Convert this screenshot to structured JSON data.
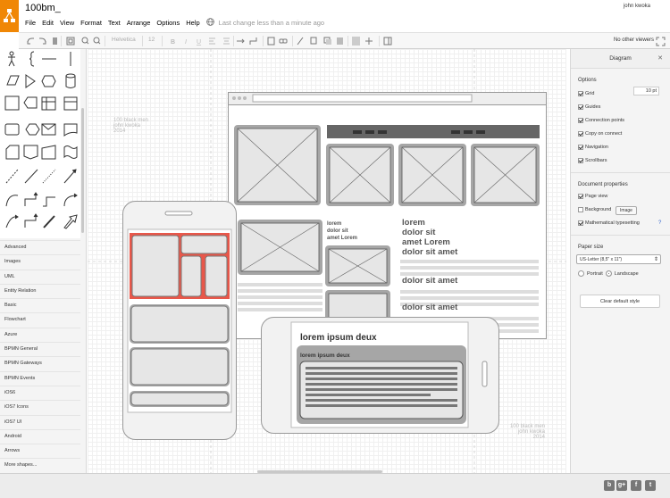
{
  "app": {
    "doc_title": "100bm_",
    "user": "john kwoka",
    "last_change": "Last change less than a minute ago",
    "menu": [
      "File",
      "Edit",
      "View",
      "Format",
      "Text",
      "Arrange",
      "Options",
      "Help"
    ]
  },
  "toolbar": {
    "font_name": "Helvetica",
    "font_size": "12",
    "viewers": "No other viewers",
    "icons": [
      "undo-icon",
      "redo-icon",
      "delete-icon",
      "fit-icon",
      "zoom-in-icon",
      "zoom-out-icon",
      "bold-icon",
      "italic-icon",
      "underline-icon",
      "align-left-icon",
      "align-center-icon",
      "valign-icon",
      "connector-icon",
      "waypoint-icon",
      "image-icon",
      "link-icon",
      "fill-icon",
      "line-color-icon",
      "shadow-icon",
      "to-front-icon",
      "grid-icon",
      "add-icon",
      "format-panel-icon",
      "fullscreen-icon"
    ]
  },
  "sidebar": {
    "libraries": [
      "Advanced",
      "Images",
      "UML",
      "Entity Relation",
      "Basic",
      "Flowchart",
      "Azure",
      "BPMN General",
      "BPMN Gateways",
      "BPMN Events",
      "iOS6",
      "iOS7 Icons",
      "iOS7 UI",
      "Android",
      "Arrows",
      "More shapes..."
    ]
  },
  "canvas": {
    "credit_top": {
      "line1": "100 black men",
      "line2": "john kwoka",
      "line3": "2014"
    },
    "credit_bottom": {
      "line1": "100 black men",
      "line2": "john kwoka",
      "line3": "2014"
    },
    "web_text": {
      "small_lines": [
        "lorem",
        "dolor sit",
        "amet Lorem"
      ],
      "big_lines": [
        "lorem",
        "dolor sit",
        "amet Lorem",
        "dolor sit amet"
      ],
      "big2": "dolor sit amet",
      "big3": "dolor sit amet"
    },
    "tablet": {
      "title": "lorem ipsum deux",
      "card_title": "lorem ipsum deux"
    }
  },
  "panel": {
    "title": "Diagram",
    "options_title": "Options",
    "grid_label": "Grid",
    "grid_size": "10 pt",
    "options": [
      {
        "label": "Guides",
        "checked": true
      },
      {
        "label": "Connection points",
        "checked": true
      },
      {
        "label": "Copy on connect",
        "checked": true
      },
      {
        "label": "Navigation",
        "checked": true
      },
      {
        "label": "Scrollbars",
        "checked": true
      }
    ],
    "doc_props_title": "Document properties",
    "page_view": "Page view",
    "background": "Background",
    "image_button": "Image",
    "math": "Mathematical typesetting",
    "help": "?",
    "paper_title": "Paper size",
    "paper_value": "US-Letter (8,5\" x 11\")",
    "portrait": "Portrait",
    "landscape": "Landscape",
    "clear_button": "Clear default style"
  },
  "footer": {
    "social": [
      "b",
      "g+",
      "f",
      "t"
    ]
  },
  "colors": {
    "orange": "#f08705",
    "red_highlight": "#e8574a",
    "placeholder": "#a6a6a6"
  }
}
